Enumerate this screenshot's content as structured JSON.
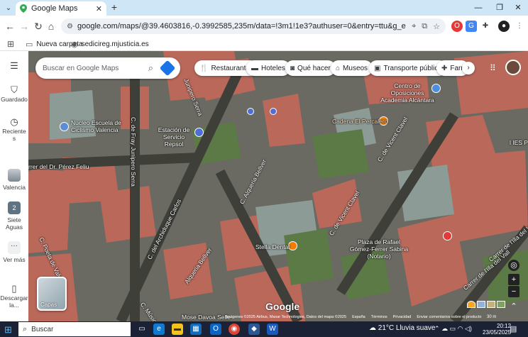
{
  "browser": {
    "tab_title": "Google Maps",
    "tab_close": "✕",
    "new_tab": "+",
    "window_controls": [
      "—",
      "❐",
      "✕"
    ],
    "url": "google.com/maps/@39.4603816,-0.3992585,235m/data=!3m1!1e3?authuser=0&entry=ttu&g_ep=EgoyMDI1MDUyMS4wIKXMDSoASA...",
    "bookmarks": [
      {
        "icon": "folder-icon",
        "label": "Nueva carpeta"
      },
      {
        "icon": "globe-icon",
        "label": "sedicireg.mjusticia.es"
      }
    ]
  },
  "maps": {
    "search_placeholder": "Buscar en Google Maps",
    "rail": {
      "menu": "☰",
      "saved": "Guardado",
      "recent": "Reciente s",
      "recent_place_1": "Valencia",
      "recent_place_2": "Siete Aguas",
      "recent_place_2_badge": "2",
      "more": "Ver más",
      "download": "Descargar la..."
    },
    "chips": [
      {
        "icon": "restaurant-icon",
        "label": "Restaurantes"
      },
      {
        "icon": "hotel-icon",
        "label": "Hoteles"
      },
      {
        "icon": "camera-icon",
        "label": "Qué hacer"
      },
      {
        "icon": "museum-icon",
        "label": "Museos"
      },
      {
        "icon": "transit-icon",
        "label": "Transporte público"
      },
      {
        "icon": "pharmacy-icon",
        "label": "Farmá"
      }
    ],
    "places": [
      {
        "name": "Centro de Oposiciones Academia Alcántara"
      },
      {
        "name": "Nucleo Escuela de Ciclismo Valencia"
      },
      {
        "name": "Estación de Servicio Repsol"
      },
      {
        "name": "Cadena El Percalero"
      },
      {
        "name": "Stella Dental"
      },
      {
        "name": "Plaza de Rafael Gómez-Ferrer Sabina (Notario)"
      }
    ],
    "streets": [
      "Junipero Serra",
      "C. de Fray Junipero Serra",
      "rrer del Dr. Pérez Feliu",
      "C. del Archiduque Carlos",
      "C. Alqueria Bellver",
      "C. de Vicent Clavel",
      "C. de Vicent Clavel",
      "C. Poeta de Valverde",
      "Alqueria Bellver",
      "Carrer de l'Illa del Vall",
      "Carrer de l'Illa del Vall",
      "C. Músico",
      "Mose Davoa Selle",
      "l IES P",
      "C. Alqueria"
    ],
    "layers_label": "Capas",
    "google_logo": "Google",
    "attribution": "Imágenes ©2025 Airbus, Maxar Technologies, Datos del mapa ©2025",
    "footer_links": [
      "España",
      "Términos",
      "Privacidad",
      "Enviar comentarios sobre el producto"
    ],
    "scale": "30 m"
  },
  "taskbar": {
    "search_label": "Buscar",
    "weather": "21°C  Lluvia suave",
    "time": "20:12",
    "date": "23/05/2025"
  }
}
